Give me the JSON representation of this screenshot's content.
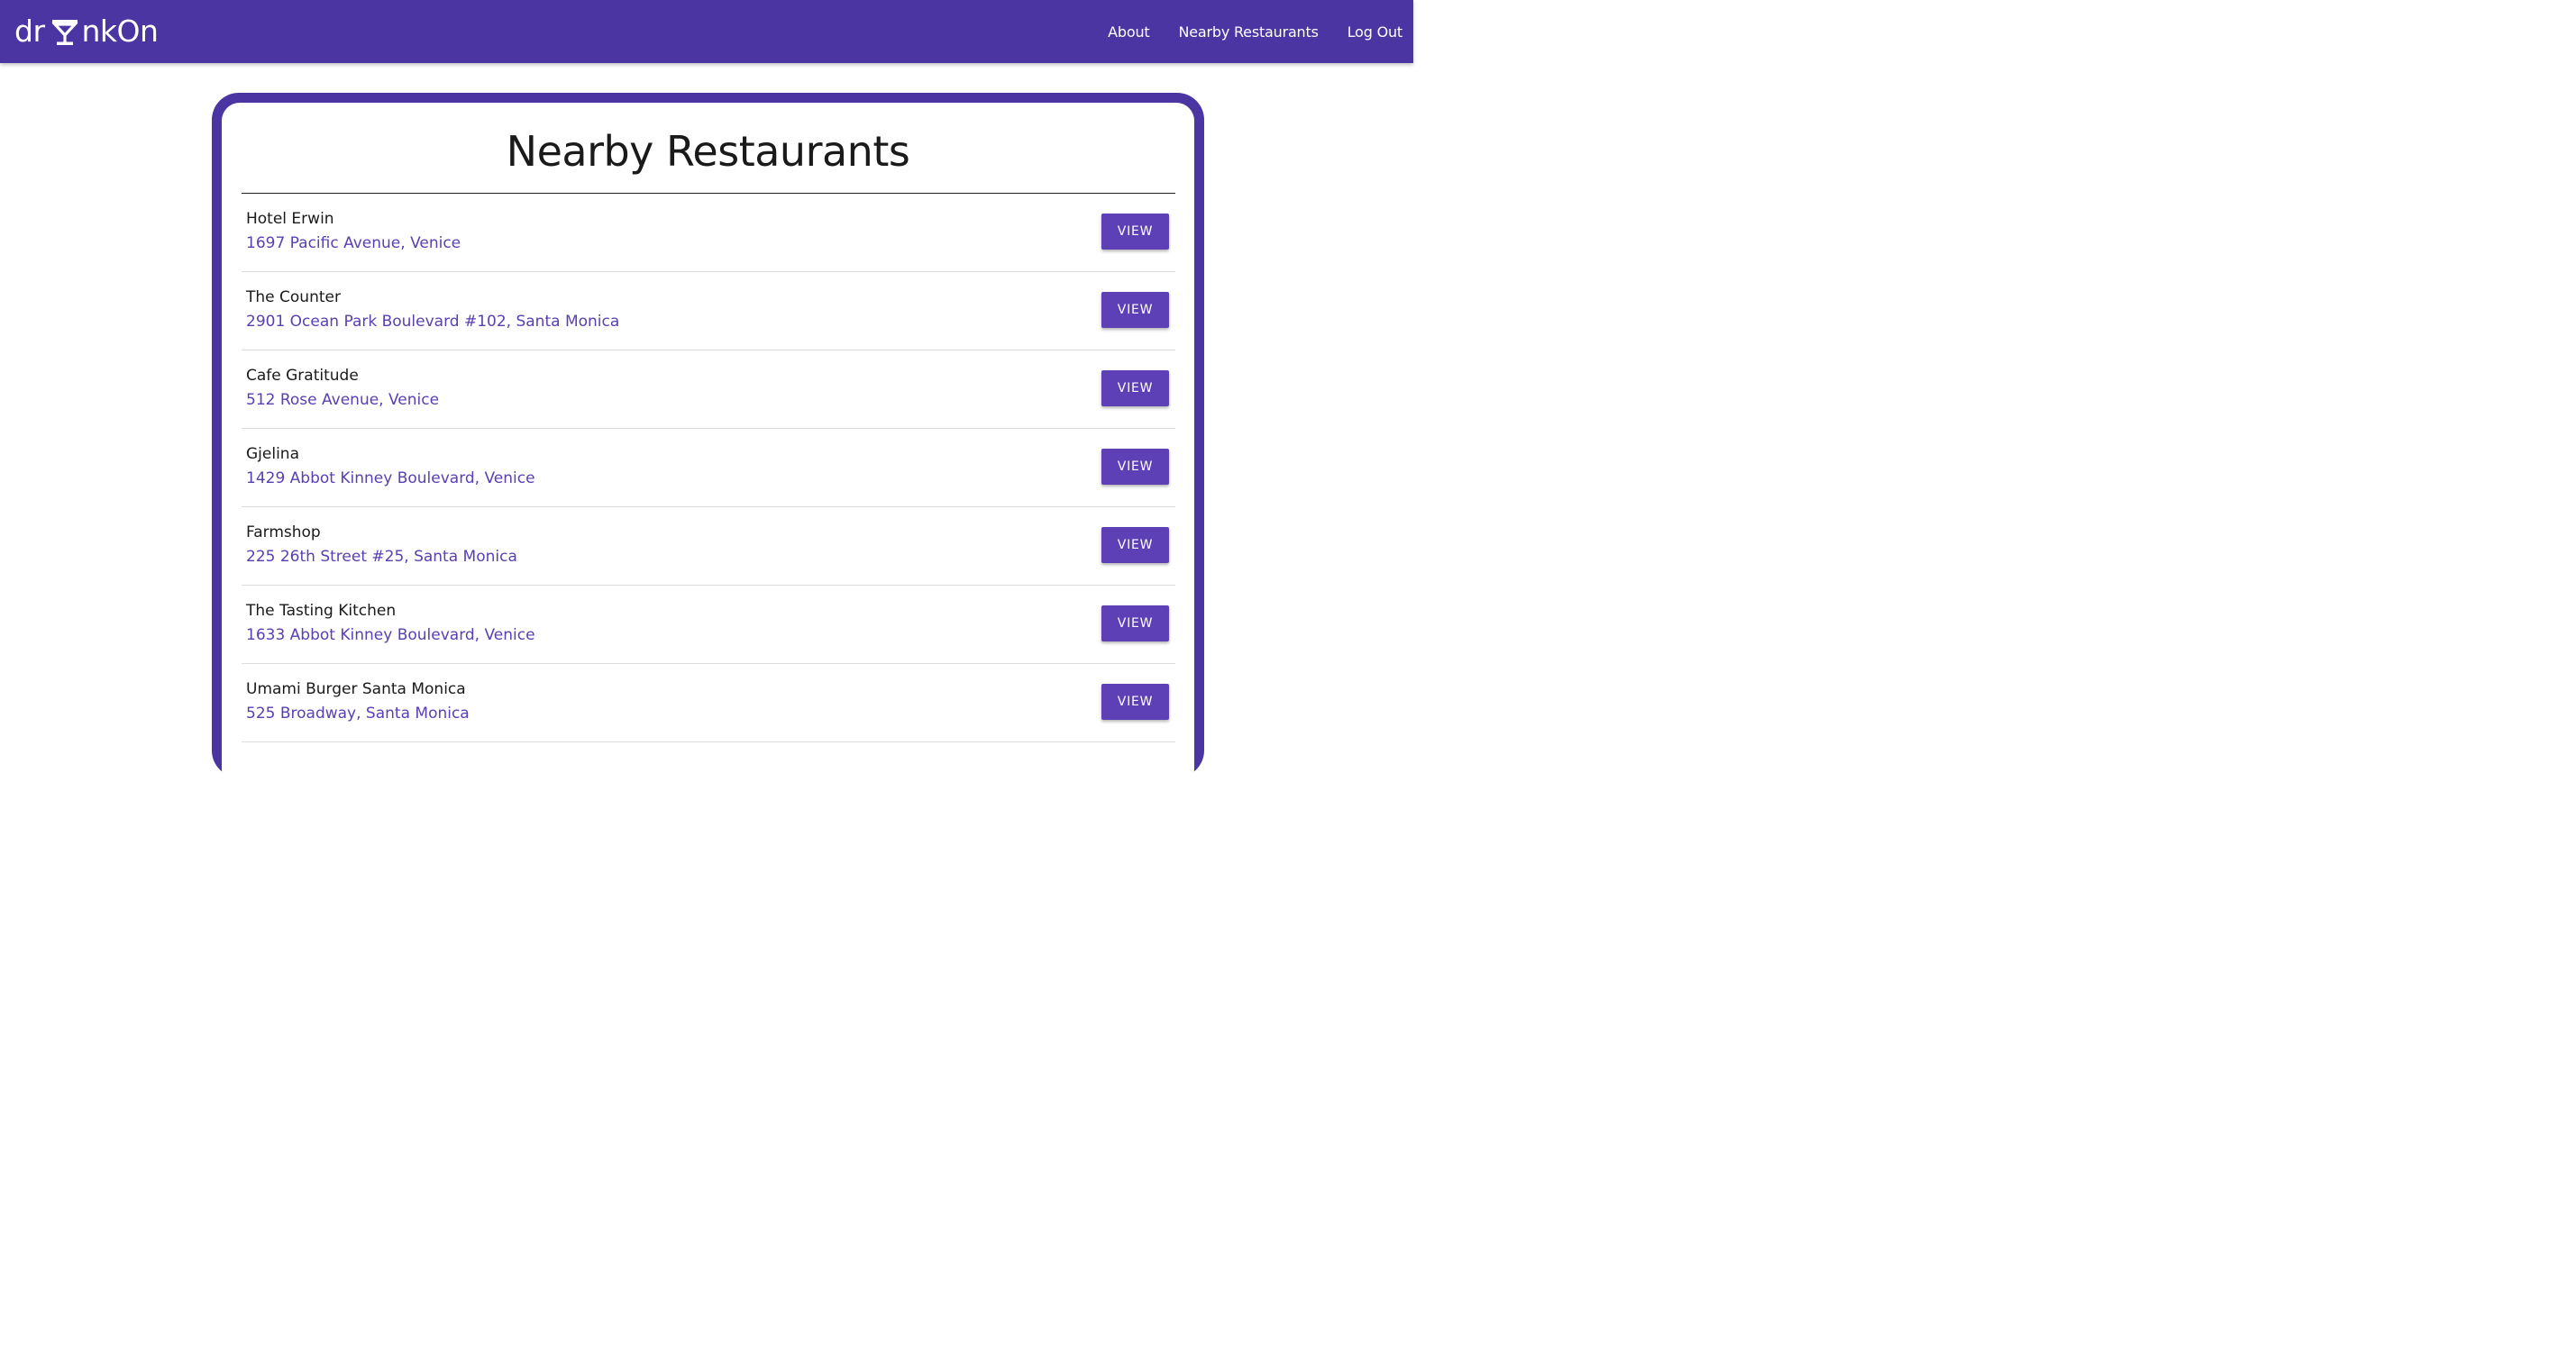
{
  "brand": {
    "prefix": "dr",
    "suffix": "nkOn",
    "icon": "cocktail-glass-icon"
  },
  "nav": {
    "links": [
      "About",
      "Nearby Restaurants",
      "Log Out"
    ]
  },
  "colors": {
    "primary": "#4b35a3",
    "button": "#5d3fb6",
    "address_text": "#5a3fb3"
  },
  "page": {
    "title": "Nearby Restaurants"
  },
  "restaurants": [
    {
      "name": "Hotel Erwin",
      "address": "1697 Pacific Avenue, Venice",
      "action": "VIEW"
    },
    {
      "name": "The Counter",
      "address": "2901 Ocean Park Boulevard #102, Santa Monica",
      "action": "VIEW"
    },
    {
      "name": "Cafe Gratitude",
      "address": "512 Rose Avenue, Venice",
      "action": "VIEW"
    },
    {
      "name": "Gjelina",
      "address": "1429 Abbot Kinney Boulevard, Venice",
      "action": "VIEW"
    },
    {
      "name": "Farmshop",
      "address": "225 26th Street #25, Santa Monica",
      "action": "VIEW"
    },
    {
      "name": "The Tasting Kitchen",
      "address": "1633 Abbot Kinney Boulevard, Venice",
      "action": "VIEW"
    },
    {
      "name": "Umami Burger Santa Monica",
      "address": "525 Broadway, Santa Monica",
      "action": "VIEW"
    }
  ]
}
